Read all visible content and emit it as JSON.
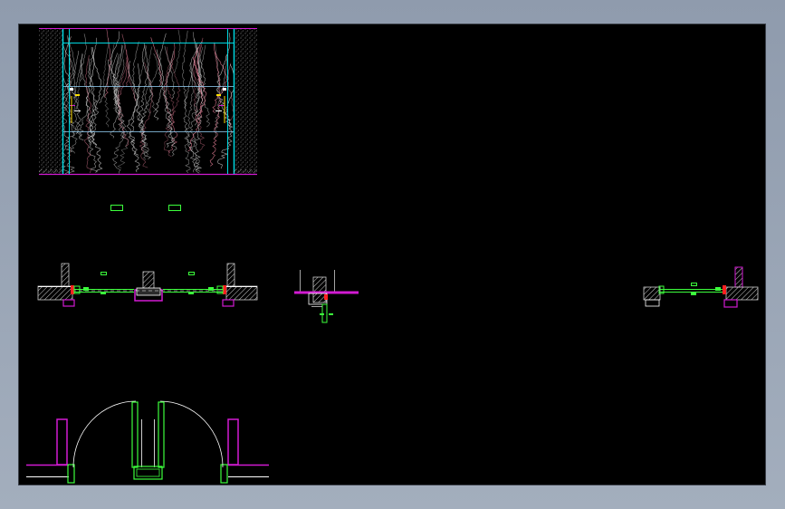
{
  "viewport": {
    "background": "#000000",
    "app_background": "#9aa6b6"
  },
  "drawing": {
    "views": [
      "elevation-wall-panel",
      "plan-partition-left",
      "section-detail-middle",
      "plan-partition-right",
      "plan-door-swing"
    ],
    "layer_colors": {
      "outline": "#ffffff",
      "wall_edge": "#00d8e0",
      "glazing": "#3cff3c",
      "trim": "#d21ad2",
      "grain_light": "#d8d8d8",
      "grain_pink": "#ff8da8",
      "hatch": "#cfcfcf",
      "marker": "#ffe000",
      "accent_red": "#ff2020"
    }
  }
}
